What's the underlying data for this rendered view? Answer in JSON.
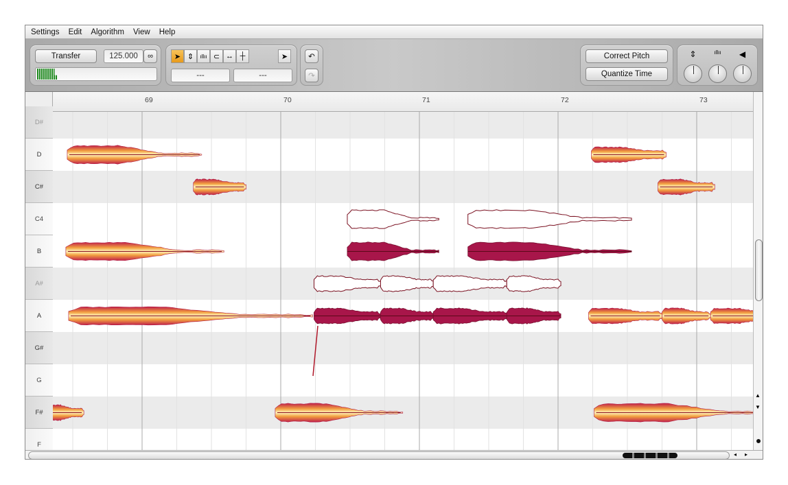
{
  "menu": [
    "Settings",
    "Edit",
    "Algorithm",
    "View",
    "Help"
  ],
  "toolbar": {
    "transfer_label": "Transfer",
    "tempo": "125.000",
    "link_icon": "link-icon",
    "field1": "---",
    "field2": "---",
    "correct_pitch": "Correct Pitch",
    "quantize_time": "Quantize Time",
    "tools": [
      {
        "icon": "main-tool-arrow-icon",
        "glyph": "➤",
        "active": true
      },
      {
        "icon": "pitch-tool-icon",
        "glyph": "⇕"
      },
      {
        "icon": "formant-tool-icon",
        "glyph": "ıllıı"
      },
      {
        "icon": "amplitude-tool-icon",
        "glyph": "⊂⊃"
      },
      {
        "icon": "time-tool-icon",
        "glyph": "↔"
      },
      {
        "icon": "separation-tool-icon",
        "glyph": "┼"
      }
    ],
    "knobs": [
      {
        "icon": "pitch-knob-icon",
        "glyph": "⇕"
      },
      {
        "icon": "formant-knob-icon",
        "glyph": "ıllıı"
      },
      {
        "icon": "volume-knob-icon",
        "glyph": "◀"
      }
    ]
  },
  "ruler": {
    "bars": [
      "69",
      "70",
      "71",
      "72",
      "73"
    ]
  },
  "keys": [
    "D#",
    "D",
    "C#",
    "C4",
    "B",
    "A#",
    "A",
    "G#",
    "G",
    "F#",
    "F"
  ],
  "colors": {
    "note_outer": "#c0204a",
    "note_inner": "#fff3b0",
    "selected": "#a8164a",
    "outline": "#7a1020",
    "row_shade": "#ebebeb"
  },
  "notes": [
    {
      "pitch": "D",
      "start": 68.46,
      "end": 69.43,
      "state": "normal"
    },
    {
      "pitch": "C#",
      "start": 69.37,
      "end": 69.75,
      "state": "normal"
    },
    {
      "pitch": "B",
      "start": 68.45,
      "end": 69.59,
      "state": "normal"
    },
    {
      "pitch": "A",
      "start": 68.47,
      "end": 70.23,
      "state": "normal"
    },
    {
      "pitch": "F#",
      "start": 68.3,
      "end": 68.58,
      "state": "normal"
    },
    {
      "pitch": "F#",
      "start": 69.96,
      "end": 70.88,
      "state": "normal"
    },
    {
      "pitch": "C4",
      "start": 70.48,
      "end": 71.14,
      "state": "target"
    },
    {
      "pitch": "C4",
      "start": 71.35,
      "end": 72.53,
      "state": "target"
    },
    {
      "pitch": "B",
      "start": 70.48,
      "end": 71.14,
      "state": "selected"
    },
    {
      "pitch": "B",
      "start": 71.35,
      "end": 72.53,
      "state": "selected"
    },
    {
      "pitch": "A#",
      "start": 70.24,
      "end": 70.72,
      "state": "target"
    },
    {
      "pitch": "A#",
      "start": 70.72,
      "end": 71.1,
      "state": "target"
    },
    {
      "pitch": "A#",
      "start": 71.1,
      "end": 71.63,
      "state": "target"
    },
    {
      "pitch": "A#",
      "start": 71.63,
      "end": 72.02,
      "state": "target"
    },
    {
      "pitch": "A",
      "start": 70.24,
      "end": 70.72,
      "state": "selected"
    },
    {
      "pitch": "A",
      "start": 70.72,
      "end": 71.1,
      "state": "selected"
    },
    {
      "pitch": "A",
      "start": 71.1,
      "end": 71.63,
      "state": "selected"
    },
    {
      "pitch": "A",
      "start": 71.63,
      "end": 72.02,
      "state": "selected"
    },
    {
      "pitch": "D",
      "start": 72.24,
      "end": 72.78,
      "state": "normal"
    },
    {
      "pitch": "C#",
      "start": 72.72,
      "end": 73.13,
      "state": "normal"
    },
    {
      "pitch": "A",
      "start": 72.22,
      "end": 72.75,
      "state": "normal"
    },
    {
      "pitch": "A",
      "start": 72.75,
      "end": 73.1,
      "state": "normal"
    },
    {
      "pitch": "A",
      "start": 73.1,
      "end": 73.6,
      "state": "normal"
    },
    {
      "pitch": "F#",
      "start": 72.26,
      "end": 73.6,
      "state": "normal"
    }
  ]
}
